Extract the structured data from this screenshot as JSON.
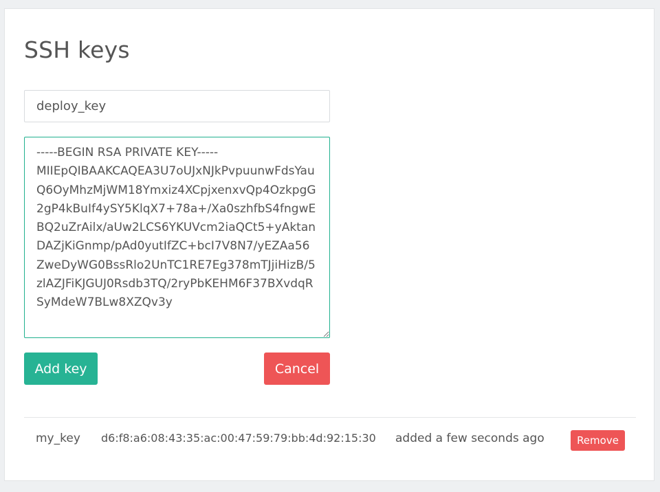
{
  "page": {
    "title": "SSH keys"
  },
  "form": {
    "name_value": "deploy_key",
    "key_value": "-----BEGIN RSA PRIVATE KEY-----\nMIIEpQIBAAKCAQEA3U7oUJxNJkPvpuunwFdsYauQ6OyMhzMjWM18Ymxiz4XCpjxenxvQp4OzkpgG2gP4kBuIf4ySY5KlqX7+78a+/Xa0szhfbS4fngwEBQ2uZrAilx/aUw2LCS6YKUVcm2iaQCt5+yAktanDAZjKiGnmp/pAd0yutIfZC+bcI7V8N7/yEZAa56ZweDyWG0BssRlo2UnTC1RE7Eg378mTJjiHizB/5zlAZJFiKJGUJ0Rsdb3TQ/2ryPbKEHM6F37BXvdqRSyMdeW7BLw8XZQv3y",
    "add_label": "Add key",
    "cancel_label": "Cancel"
  },
  "keys": [
    {
      "name": "my_key",
      "fingerprint": "d6:f8:a6:08:43:35:ac:00:47:59:79:bb:4d:92:15:30",
      "added": "added a few seconds ago",
      "remove_label": "Remove"
    }
  ],
  "colors": {
    "accent_green": "#27b394",
    "danger_red": "#ee5556",
    "focus_border": "#1fb08e"
  }
}
